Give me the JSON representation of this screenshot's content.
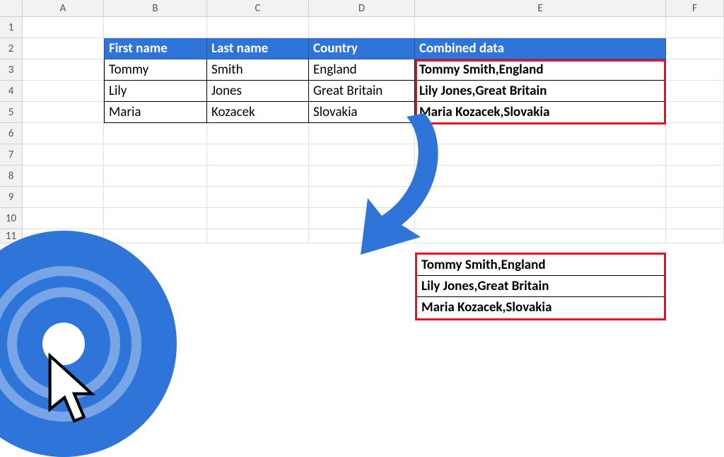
{
  "columns": {
    "A": "A",
    "B": "B",
    "C": "C",
    "D": "D",
    "E": "E",
    "F": "F"
  },
  "rowlabels": [
    "1",
    "2",
    "3",
    "4",
    "5",
    "6",
    "7",
    "8",
    "9",
    "10",
    "11"
  ],
  "headers": {
    "first": "First name",
    "last": "Last name",
    "country": "Country",
    "combined": "Combined data"
  },
  "data": [
    {
      "first": "Tommy",
      "last": "Smith",
      "country": "England",
      "combined": "Tommy Smith,England"
    },
    {
      "first": "Lily",
      "last": "Jones",
      "country": "Great Britain",
      "combined": "Lily  Jones,Great Britain"
    },
    {
      "first": "Maria",
      "last": "Kozacek",
      "country": "Slovakia",
      "combined": "Maria Kozacek,Slovakia"
    }
  ],
  "colors": {
    "header_bg": "#2f75d9",
    "highlight": "#e81123"
  },
  "chart_data": {
    "type": "table",
    "title": "",
    "columns": [
      "First name",
      "Last name",
      "Country",
      "Combined data"
    ],
    "rows": [
      [
        "Tommy",
        "Smith",
        "England",
        "Tommy Smith,England"
      ],
      [
        "Lily",
        "Jones",
        "Great Britain",
        "Lily  Jones,Great Britain"
      ],
      [
        "Maria",
        "Kozacek",
        "Slovakia",
        "Maria Kozacek,Slovakia"
      ]
    ]
  }
}
